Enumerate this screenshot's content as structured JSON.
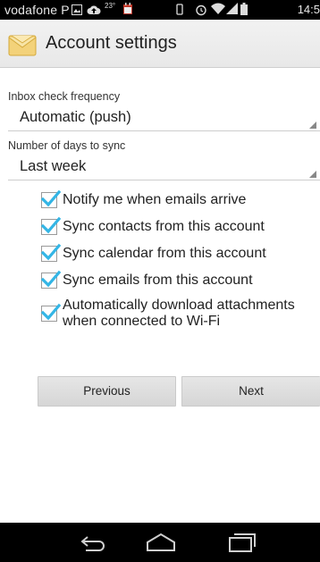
{
  "status_bar": {
    "carrier": "vodafone P",
    "temp_small": "23°",
    "time": "14:5"
  },
  "header": {
    "title": "Account settings",
    "icon": "mail-envelope-icon"
  },
  "form": {
    "inbox_check": {
      "label": "Inbox check frequency",
      "value": "Automatic (push)"
    },
    "days_to_sync": {
      "label": "Number of days to sync",
      "value": "Last week"
    },
    "checkboxes": [
      {
        "label": "Notify me when emails arrive",
        "checked": true
      },
      {
        "label": "Sync contacts from this account",
        "checked": true
      },
      {
        "label": "Sync calendar from this account",
        "checked": true
      },
      {
        "label": "Sync emails from this account",
        "checked": true
      },
      {
        "label_line1": "Automatically download attachments",
        "label_line2": "when connected to Wi-Fi",
        "checked": true
      }
    ]
  },
  "buttons": {
    "previous": "Previous",
    "next": "Next"
  },
  "nav_bar": {
    "icons": [
      "back-icon",
      "home-icon",
      "recent-apps-icon"
    ]
  },
  "colors": {
    "accent": "#33b5e5",
    "status_bar_bg": "#000000",
    "action_bar_bg": "#eeeeee"
  }
}
